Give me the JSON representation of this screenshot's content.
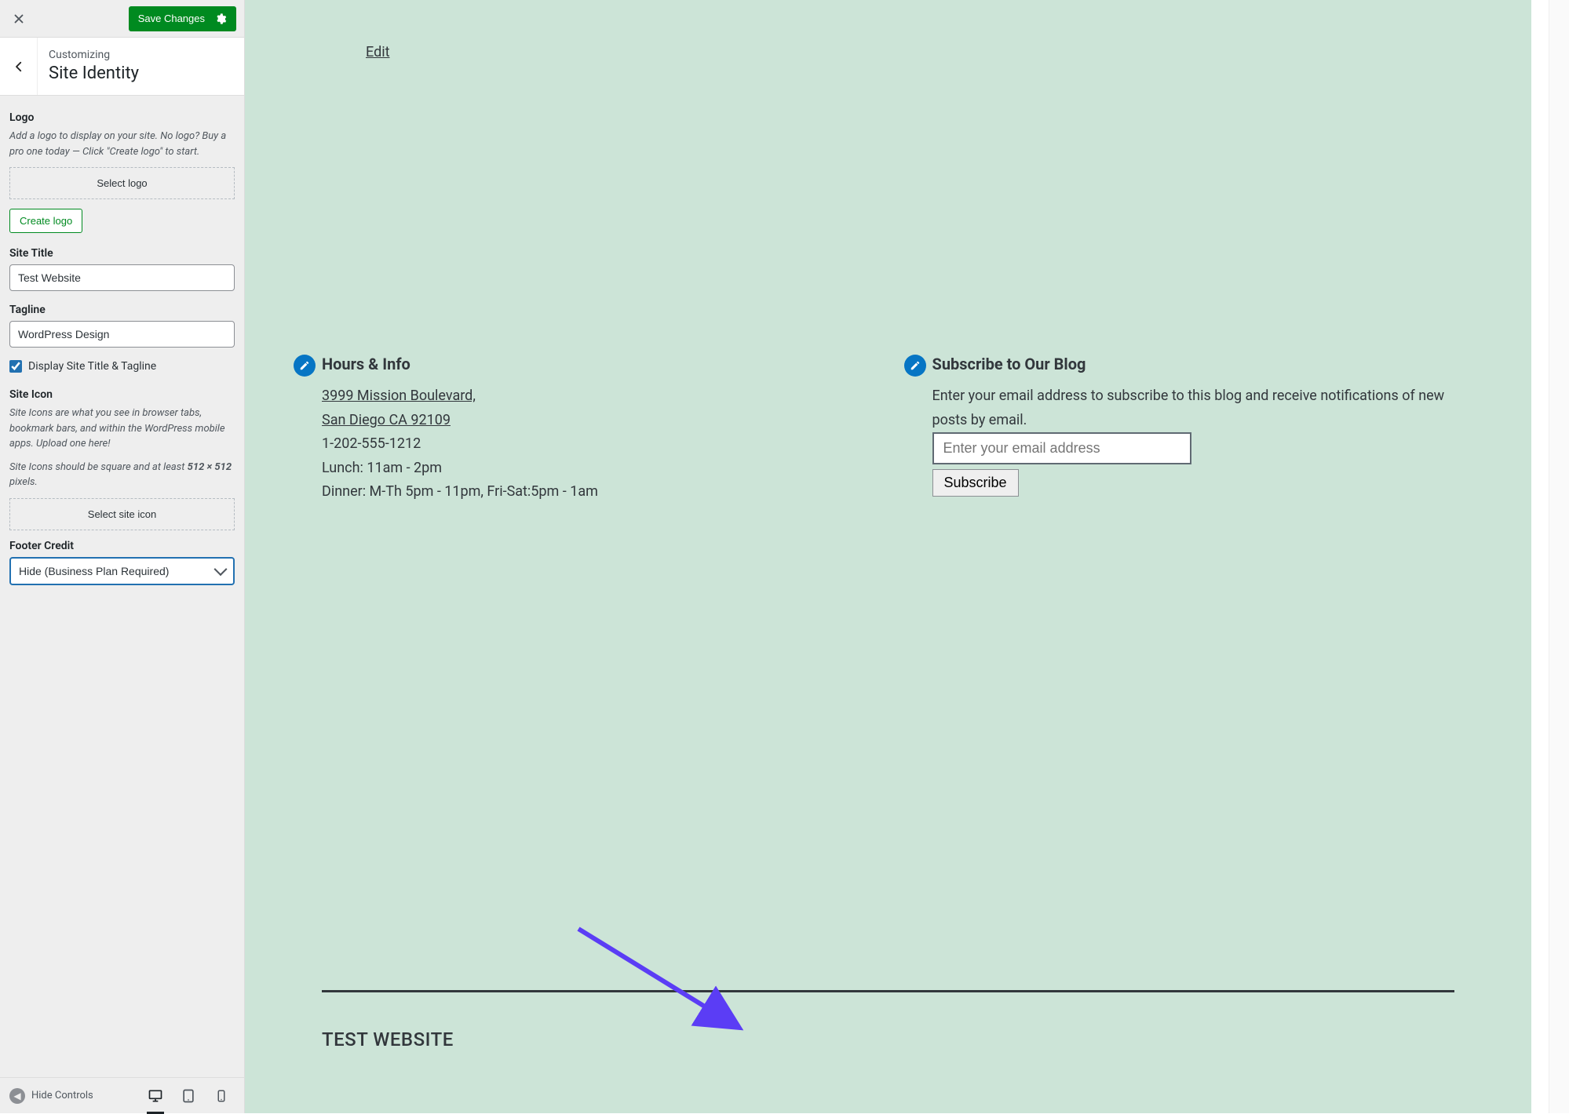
{
  "topbar": {
    "save_label": "Save Changes"
  },
  "panel": {
    "pre": "Customizing",
    "title": "Site Identity"
  },
  "logo": {
    "heading": "Logo",
    "desc": "Add a logo to display on your site. No logo? Buy a pro one today — Click \"Create logo\" to start.",
    "select_label": "Select logo",
    "create_label": "Create logo"
  },
  "site_title": {
    "label": "Site Title",
    "value": "Test Website"
  },
  "tagline": {
    "label": "Tagline",
    "value": "WordPress Design"
  },
  "display_toggle": {
    "label": "Display Site Title & Tagline",
    "checked": true
  },
  "site_icon": {
    "heading": "Site Icon",
    "desc1": "Site Icons are what you see in browser tabs, bookmark bars, and within the WordPress mobile apps. Upload one here!",
    "desc2_pre": "Site Icons should be square and at least ",
    "desc2_strong": "512 × 512",
    "desc2_post": " pixels.",
    "select_label": "Select site icon"
  },
  "footer_credit": {
    "label": "Footer Credit",
    "value": "Hide (Business Plan Required)"
  },
  "footer_bar": {
    "hide_label": "Hide Controls"
  },
  "preview": {
    "edit_link": "Edit",
    "hours": {
      "title": "Hours & Info",
      "addr1": "3999 Mission Boulevard,",
      "addr2": "San Diego CA 92109",
      "phone": "1-202-555-1212",
      "lunch": "Lunch: 11am - 2pm",
      "dinner": "Dinner: M-Th 5pm - 11pm, Fri-Sat:5pm - 1am"
    },
    "subscribe": {
      "title": "Subscribe to Our Blog",
      "desc": "Enter your email address to subscribe to this blog and receive notifications of new posts by email.",
      "placeholder": "Enter your email address",
      "button": "Subscribe"
    },
    "footer_title": "TEST WEBSITE"
  }
}
